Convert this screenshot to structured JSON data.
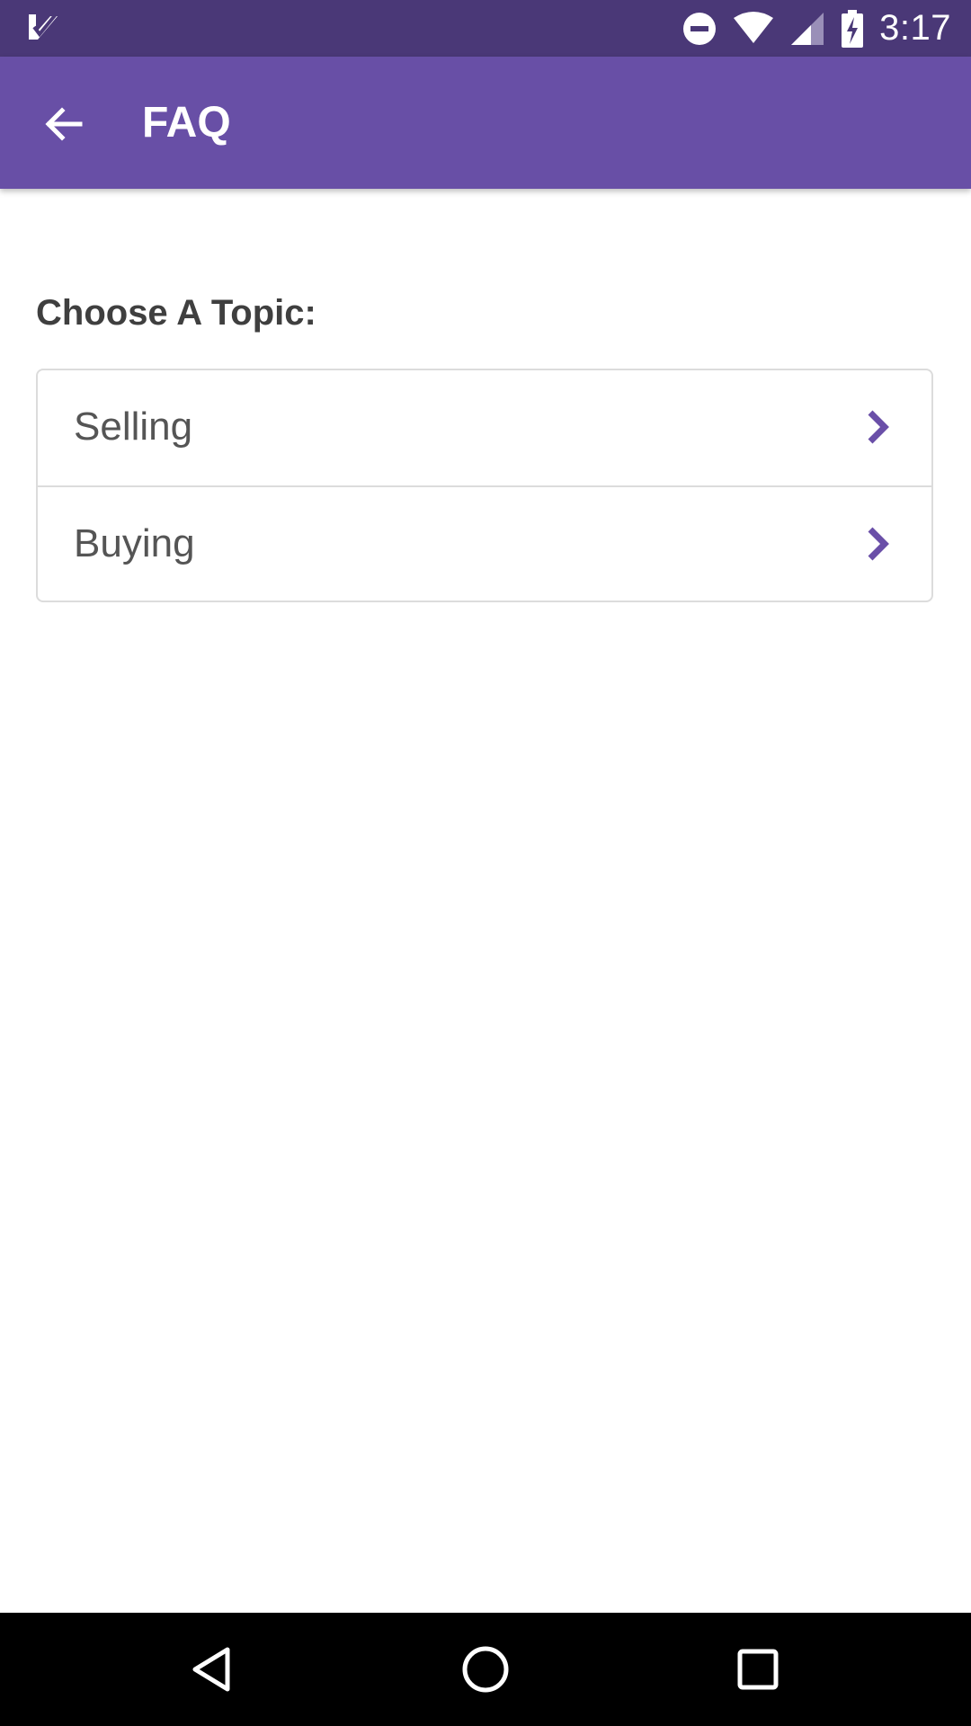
{
  "status_bar": {
    "time": "3:17",
    "icons": [
      "app-notification-icon",
      "do-not-disturb-icon",
      "wifi-icon",
      "cell-signal-icon",
      "battery-charging-icon"
    ]
  },
  "app_bar": {
    "title": "FAQ",
    "back_icon": "arrow-back-icon"
  },
  "content": {
    "heading": "Choose A Topic:",
    "topics": [
      {
        "label": "Selling",
        "icon": "chevron-right-icon"
      },
      {
        "label": "Buying",
        "icon": "chevron-right-icon"
      }
    ]
  },
  "nav_bar": {
    "icons": [
      "back-triangle-icon",
      "home-circle-icon",
      "recents-square-icon"
    ]
  },
  "colors": {
    "status_bar": "#4a3877",
    "app_bar": "#684fa6",
    "accent": "#6a4fa8",
    "heading_text": "#3f3f3f",
    "item_text": "#555555",
    "border": "#dcdcdc",
    "nav_bar": "#000000"
  }
}
